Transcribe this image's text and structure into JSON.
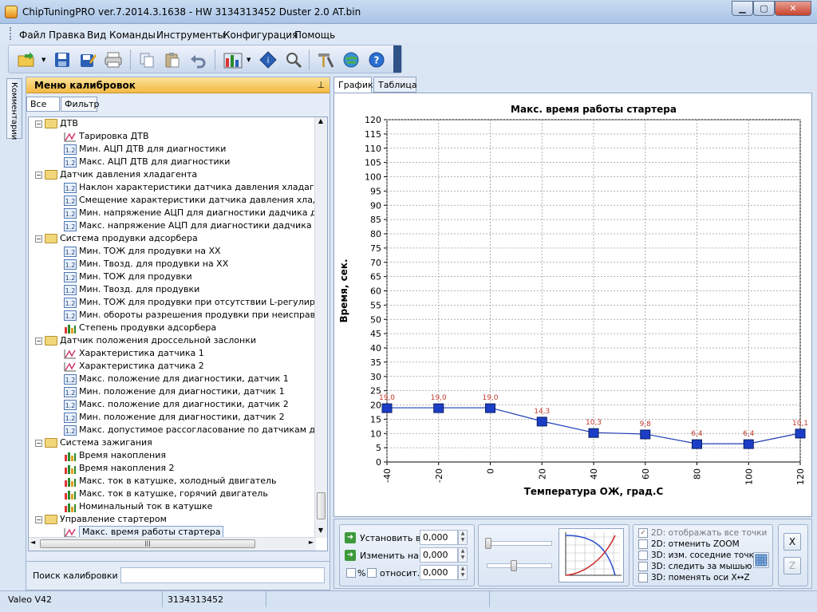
{
  "window": {
    "title": "ChipTuningPRO ver.7.2014.3.1638 - HW 3134313452 Duster 2.0 AT.bin"
  },
  "menu": [
    "Файл",
    "Правка",
    "Вид",
    "Команды",
    "Инструменты",
    "Конфигурация",
    "Помощь"
  ],
  "toolbar": {
    "icons": [
      "open-folder-icon",
      "save-icon",
      "save-as-icon",
      "print-icon",
      "copy-icon",
      "paste-icon",
      "undo-icon",
      "chart-view-icon",
      "info-icon",
      "zoom-icon",
      "tools-icon",
      "web-update-icon",
      "help-icon"
    ]
  },
  "side_tab": "Комментарии",
  "left_panel": {
    "title": "Меню калибровок",
    "tabs": [
      "Все",
      "Фильтр"
    ],
    "tree": [
      {
        "type": "folder",
        "label": "ДТВ"
      },
      {
        "type": "curve",
        "label": "Тарировка ДТВ"
      },
      {
        "type": "const",
        "label": "Мин. АЦП ДТВ для диагностики"
      },
      {
        "type": "const",
        "label": "Макс. АЦП ДТВ для диагностики"
      },
      {
        "type": "folder",
        "label": "Датчик давления хладагента"
      },
      {
        "type": "const",
        "label": "Наклон характеристики датчика давления хладагента"
      },
      {
        "type": "const",
        "label": "Смещение характеристики датчика давления хладагент"
      },
      {
        "type": "const",
        "label": "Мин. напряжение АЦП для диагностики дадчика давлен"
      },
      {
        "type": "const",
        "label": "Макс. напряжение АЦП для диагностики дадчика давле"
      },
      {
        "type": "folder",
        "label": "Система продувки адсорбера"
      },
      {
        "type": "const",
        "label": "Мин. ТОЖ для продувки на ХХ"
      },
      {
        "type": "const",
        "label": "Мин. Твозд. для продувки на ХХ"
      },
      {
        "type": "const",
        "label": "Мин. ТОЖ для продувки"
      },
      {
        "type": "const",
        "label": "Мин. Твозд. для продувки"
      },
      {
        "type": "const",
        "label": "Мин. ТОЖ для продувки при отсутствии L-регулирования"
      },
      {
        "type": "const",
        "label": "Мин. обороты разрешения продувки при неисправностях"
      },
      {
        "type": "map",
        "label": "Степень продувки адсорбера"
      },
      {
        "type": "folder",
        "label": "Датчик положения дроссельной заслонки"
      },
      {
        "type": "curve",
        "label": "Характеристика датчика 1"
      },
      {
        "type": "curve",
        "label": "Характеристика датчика 2"
      },
      {
        "type": "const",
        "label": "Макс. положение для диагностики, датчик 1"
      },
      {
        "type": "const",
        "label": "Мин. положение для диагностики, датчик 1"
      },
      {
        "type": "const",
        "label": "Макс. положение для диагностики, датчик 2"
      },
      {
        "type": "const",
        "label": "Мин. положение для диагностики, датчик 2"
      },
      {
        "type": "const",
        "label": "Макс. допустимое рассогласование по датчикам для диа"
      },
      {
        "type": "folder",
        "label": "Система зажигания"
      },
      {
        "type": "map",
        "label": "Время накопления"
      },
      {
        "type": "map",
        "label": "Время накопления 2"
      },
      {
        "type": "map",
        "label": "Макс. ток в катушке, холодный двигатель"
      },
      {
        "type": "map",
        "label": "Макс. ток в катушке, горячий двигатель"
      },
      {
        "type": "map",
        "label": "Номинальный ток в катушке"
      },
      {
        "type": "folder",
        "label": "Управление стартером"
      },
      {
        "type": "curve",
        "label": "Макс. время работы стартера",
        "selected": true
      }
    ],
    "search_label": "Поиск калибровки",
    "search_value": ""
  },
  "right_tabs": [
    "График",
    "Таблица"
  ],
  "chart_data": {
    "type": "line",
    "title": "Макс. время работы стартера",
    "xlabel": "Температура ОЖ, град.С",
    "ylabel": "Время, сек.",
    "x": [
      -40,
      -20,
      0,
      20,
      40,
      60,
      80,
      100,
      120
    ],
    "values": [
      19.0,
      19.0,
      19.0,
      14.3,
      10.3,
      9.8,
      6.4,
      6.4,
      10.1
    ],
    "data_labels": [
      "19,0",
      "19,0",
      "19,0",
      "14,3",
      "10,3",
      "9,8",
      "6,4",
      "6,4",
      "10,1"
    ],
    "xlim": [
      -40,
      120
    ],
    "ylim": [
      0,
      120
    ],
    "yticks": [
      0,
      5,
      10,
      15,
      20,
      25,
      30,
      35,
      40,
      45,
      50,
      55,
      60,
      65,
      70,
      75,
      80,
      85,
      90,
      95,
      100,
      105,
      110,
      115,
      120
    ],
    "xticks": [
      "-40",
      "-20",
      "0",
      "20",
      "40",
      "60",
      "80",
      "100",
      "120"
    ],
    "grid": true,
    "line_color": "#1f3fb7",
    "marker_color": "#1c3ec6",
    "label_color": "#c0392b"
  },
  "controls": {
    "set_label": "Установить в",
    "set_value": "0,000",
    "change_label": "Изменить на",
    "change_value": "0,000",
    "percent_label": "%",
    "relative_label": "относит.",
    "relative_value": "0,000",
    "options": [
      {
        "label": "2D: отображать все точки",
        "checked": true,
        "disabled": true
      },
      {
        "label": "2D: отменить ZOOM",
        "checked": false
      },
      {
        "label": "3D: изм. соседние точки",
        "checked": false
      },
      {
        "label": "3D: следить за мышью",
        "checked": false
      },
      {
        "label": "3D: поменять оси X↔Z",
        "checked": false
      }
    ],
    "btn_x": "X",
    "btn_z": "Z"
  },
  "status": {
    "ecu": "Valeo V42",
    "hw": "3134313452"
  }
}
